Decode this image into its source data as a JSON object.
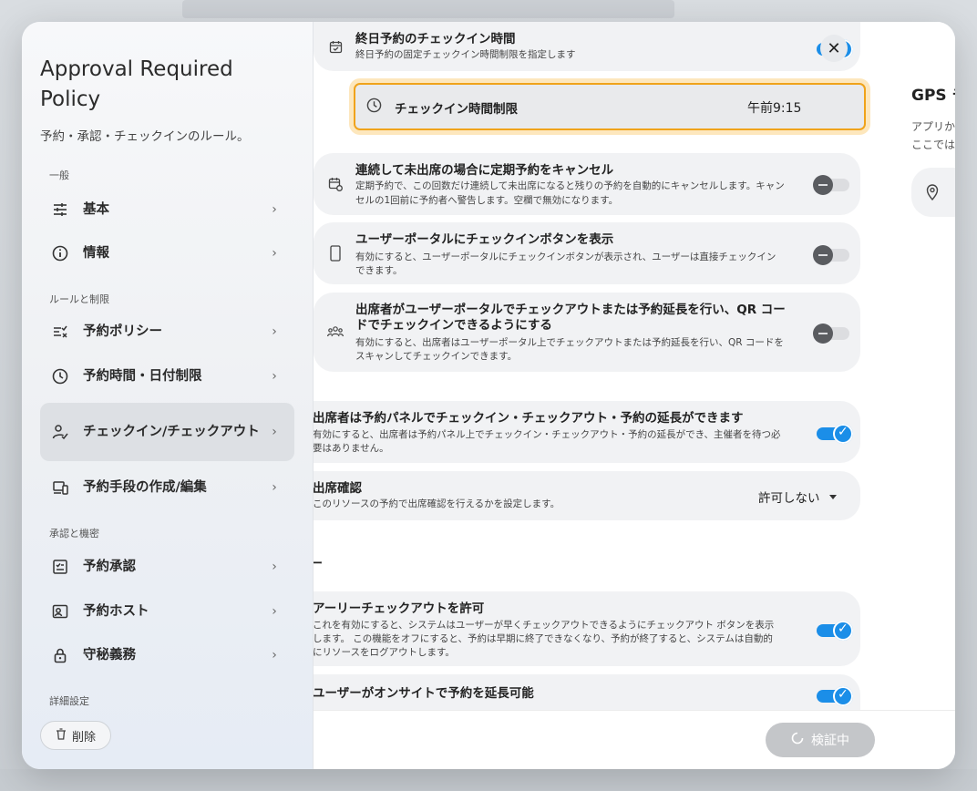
{
  "sidebar": {
    "title": "Approval Required Policy",
    "subtitle": "予約・承認・チェックインのルール。",
    "sections": {
      "general": "一般",
      "rules": "ルールと制限",
      "approval": "承認と機密",
      "advanced": "詳細設定"
    },
    "items": [
      {
        "label": "基本",
        "icon": "sliders-icon"
      },
      {
        "label": "情報",
        "icon": "info-icon"
      },
      {
        "label": "予約ポリシー",
        "icon": "checklist-icon"
      },
      {
        "label": "予約時間・日付制限",
        "icon": "clock-icon"
      },
      {
        "label": "チェックイン/チェックアウト",
        "icon": "user-check-icon"
      },
      {
        "label": "予約手段の作成/編集",
        "icon": "devices-icon"
      },
      {
        "label": "予約承認",
        "icon": "approval-icon"
      },
      {
        "label": "予約ホスト",
        "icon": "host-icon"
      },
      {
        "label": "守秘義務",
        "icon": "lock-icon"
      }
    ],
    "delete_label": "削除"
  },
  "content": {
    "allday": {
      "title": "終日予約のチェックイン時間",
      "desc": "終日予約の固定チェックイン時間制限を指定します",
      "enabled": true
    },
    "checkin_limit": {
      "label": "チェックイン時間制限",
      "value": "午前9:15"
    },
    "cancel_recurring": {
      "title": "連続して未出席の場合に定期予約をキャンセル",
      "desc1": "定期予約で、この回数だけ連続して未出席になると残りの予約を自動的にキャンセルします。キャン",
      "desc2": "セルの1回前に予約者へ警告します。空欄で無効になります。",
      "enabled": false
    },
    "portal_button": {
      "title": "ユーザーポータルにチェックインボタンを表示",
      "desc1": "有効にすると、ユーザーポータルにチェックインボタンが表示され、ユーザーは直接チェックイン",
      "desc2": "できます。",
      "enabled": false
    },
    "attendee_portal": {
      "title1": "出席者がユーザーポータルでチェックアウトまたは予約延長を行い、QR コー",
      "title2": "ドでチェックインできるようにする",
      "desc1": "有効にすると、出席者はユーザーポータル上でチェックアウトまたは予約延長を行い、QR コードを",
      "desc2": "スキャンしてチェックインできます。",
      "enabled": false
    },
    "panel_checkin": {
      "title": "出席者は予約パネルでチェックイン・チェックアウト・予約の延長ができます",
      "desc1": "有効にすると、出席者は予約パネル上でチェックイン・チェックアウト・予約の延長ができ、主催者を待つ必",
      "desc2": "要はありません。",
      "enabled": true
    },
    "attendance": {
      "title": "出席確認",
      "desc": "このリソースの予約で出席確認を行えるかを設定します。",
      "value": "許可しない"
    },
    "section_fragment": "ー",
    "early_checkout": {
      "title": "アーリーチェックアウトを許可",
      "desc1": "これを有効にすると、システムはユーザーが早くチェックアウトできるようにチェックアウト ボタンを表示",
      "desc2": "します。 この機能をオフにすると、予約は早期に終了できなくなり、予約が終了すると、システムは自動的",
      "desc3": "にリソースをログアウトします。",
      "enabled": true
    },
    "onsite_extend": {
      "title": "ユーザーがオンサイトで予約を延長可能",
      "enabled": true
    }
  },
  "right_panel": {
    "title": "GPS チ",
    "desc1": "アプリか",
    "desc2": "ここでは"
  },
  "footer": {
    "verify_label": "検証中"
  },
  "colors": {
    "accent": "#1b8ee8",
    "highlight_border": "#f0a31b"
  }
}
